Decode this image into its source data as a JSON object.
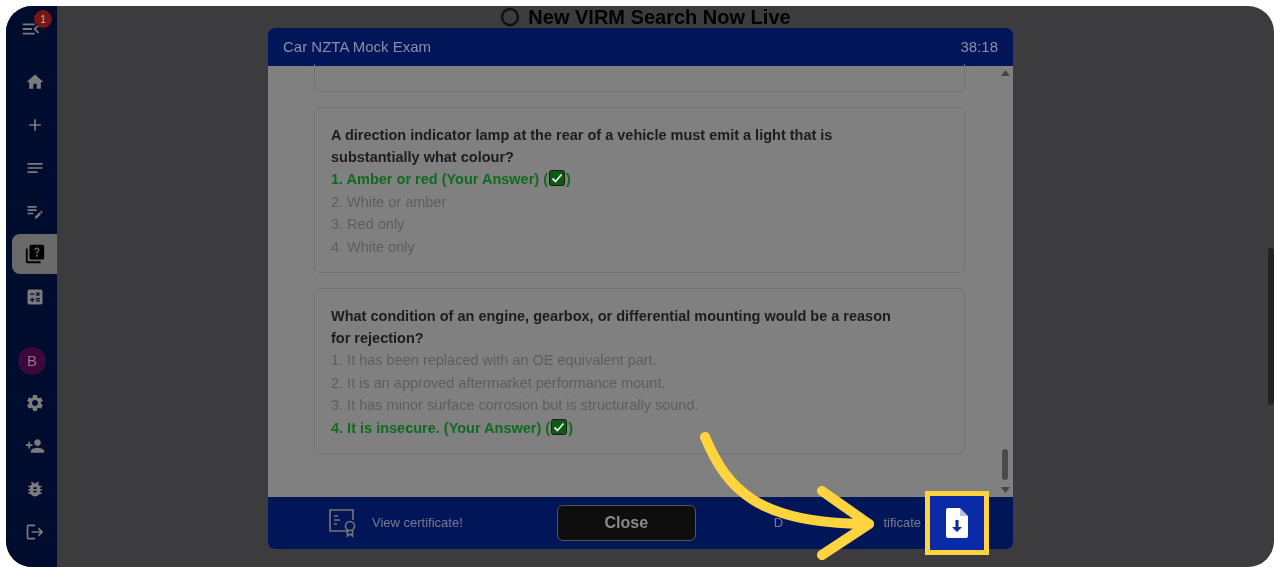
{
  "sidebar": {
    "badge": "1",
    "avatar": "B",
    "items": [
      {
        "kind": "home",
        "selected": false
      },
      {
        "kind": "add",
        "selected": false
      },
      {
        "kind": "list",
        "selected": false
      },
      {
        "kind": "edit-list",
        "selected": false
      },
      {
        "kind": "quiz",
        "selected": true
      },
      {
        "kind": "calculator",
        "selected": false
      }
    ],
    "bottom_items": [
      {
        "kind": "settings"
      },
      {
        "kind": "add-user"
      },
      {
        "kind": "bug"
      },
      {
        "kind": "logout"
      }
    ]
  },
  "page": {
    "banner": "New VIRM Search Now Live"
  },
  "modal": {
    "title": "Car NZTA Mock Exam",
    "timer": "38:18",
    "questions": [
      {
        "question": "A direction indicator lamp at the rear of a vehicle must emit a light that is substantially what colour?",
        "options": [
          {
            "text": "1. Amber or red (Your Answer) (",
            "close": ")",
            "selected": true
          },
          {
            "text": "2. White or amber",
            "selected": false
          },
          {
            "text": "3. Red only",
            "selected": false
          },
          {
            "text": "4. White only",
            "selected": false
          }
        ]
      },
      {
        "question": "What condition of an engine, gearbox, or differential mounting would be a reason for rejection?",
        "options": [
          {
            "text": "1. It has been replaced with an OE equivalent part.",
            "selected": false
          },
          {
            "text": "2. It is an approved aftermarket performance mount.",
            "selected": false
          },
          {
            "text": "3. It has minor surface corrosion but is structurally sound.",
            "selected": false
          },
          {
            "text": "4. It is insecure. (Your Answer) (",
            "close": ")",
            "selected": true
          }
        ]
      }
    ],
    "footer": {
      "view_certificate": "View certificate!",
      "close": "Close",
      "download_start": "D",
      "download_end": "tificate"
    }
  }
}
